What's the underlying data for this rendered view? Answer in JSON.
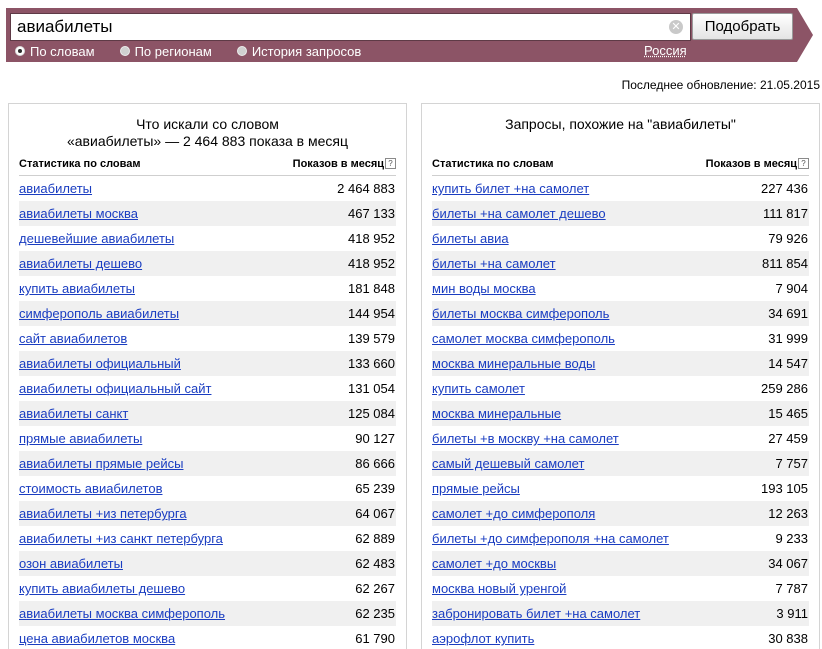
{
  "search": {
    "query": "авиабилеты",
    "submit_label": "Подобрать",
    "clear_glyph": "✕",
    "modes": [
      {
        "label": "По словам",
        "selected": true
      },
      {
        "label": "По регионам",
        "selected": false
      },
      {
        "label": "История запросов",
        "selected": false
      }
    ],
    "region": "Россия"
  },
  "last_update": "Последнее обновление: 21.05.2015",
  "left_panel": {
    "title_line1": "Что искали со словом",
    "title_line2": "«авиабилеты» — 2 464 883 показа в месяц",
    "col_phrase": "Статистика по словам",
    "col_count": "Показов в месяц",
    "help_glyph": "?",
    "rows": [
      {
        "phrase": "авиабилеты",
        "count": "2 464 883"
      },
      {
        "phrase": "авиабилеты москва",
        "count": "467 133"
      },
      {
        "phrase": "дешевейшие авиабилеты",
        "count": "418 952"
      },
      {
        "phrase": "авиабилеты дешево",
        "count": "418 952"
      },
      {
        "phrase": "купить авиабилеты",
        "count": "181 848"
      },
      {
        "phrase": "симферополь авиабилеты",
        "count": "144 954"
      },
      {
        "phrase": "сайт авиабилетов",
        "count": "139 579"
      },
      {
        "phrase": "авиабилеты официальный",
        "count": "133 660"
      },
      {
        "phrase": "авиабилеты официальный сайт",
        "count": "131 054"
      },
      {
        "phrase": "авиабилеты санкт",
        "count": "125 084"
      },
      {
        "phrase": "прямые авиабилеты",
        "count": "90 127"
      },
      {
        "phrase": "авиабилеты прямые рейсы",
        "count": "86 666"
      },
      {
        "phrase": "стоимость авиабилетов",
        "count": "65 239"
      },
      {
        "phrase": "авиабилеты +из петербурга",
        "count": "64 067"
      },
      {
        "phrase": "авиабилеты +из санкт петербурга",
        "count": "62 889"
      },
      {
        "phrase": "озон авиабилеты",
        "count": "62 483"
      },
      {
        "phrase": "купить авиабилеты дешево",
        "count": "62 267"
      },
      {
        "phrase": "авиабилеты москва симферополь",
        "count": "62 235"
      },
      {
        "phrase": "цена авиабилетов москва",
        "count": "61 790"
      }
    ]
  },
  "right_panel": {
    "title": "Запросы, похожие на \"авиабилеты\"",
    "col_phrase": "Статистика по словам",
    "col_count": "Показов в месяц",
    "help_glyph": "?",
    "rows": [
      {
        "phrase": "купить билет +на самолет",
        "count": "227 436"
      },
      {
        "phrase": "билеты +на самолет дешево",
        "count": "111 817"
      },
      {
        "phrase": "билеты авиа",
        "count": "79 926"
      },
      {
        "phrase": "билеты +на самолет",
        "count": "811 854"
      },
      {
        "phrase": "мин воды москва",
        "count": "7 904"
      },
      {
        "phrase": "билеты москва симферополь",
        "count": "34 691"
      },
      {
        "phrase": "самолет москва симферополь",
        "count": "31 999"
      },
      {
        "phrase": "москва минеральные воды",
        "count": "14 547"
      },
      {
        "phrase": "купить самолет",
        "count": "259 286"
      },
      {
        "phrase": "москва минеральные",
        "count": "15 465"
      },
      {
        "phrase": "билеты +в москву +на самолет",
        "count": "27 459"
      },
      {
        "phrase": "самый дешевый самолет",
        "count": "7 757"
      },
      {
        "phrase": "прямые рейсы",
        "count": "193 105"
      },
      {
        "phrase": "самолет +до симферополя",
        "count": "12 263"
      },
      {
        "phrase": "билеты +до симферополя +на самолет",
        "count": "9 233"
      },
      {
        "phrase": "самолет +до москвы",
        "count": "34 067"
      },
      {
        "phrase": "москва новый уренгой",
        "count": "7 787"
      },
      {
        "phrase": "забронировать билет +на самолет",
        "count": "3 911"
      },
      {
        "phrase": "аэрофлот купить",
        "count": "30 838"
      }
    ]
  }
}
